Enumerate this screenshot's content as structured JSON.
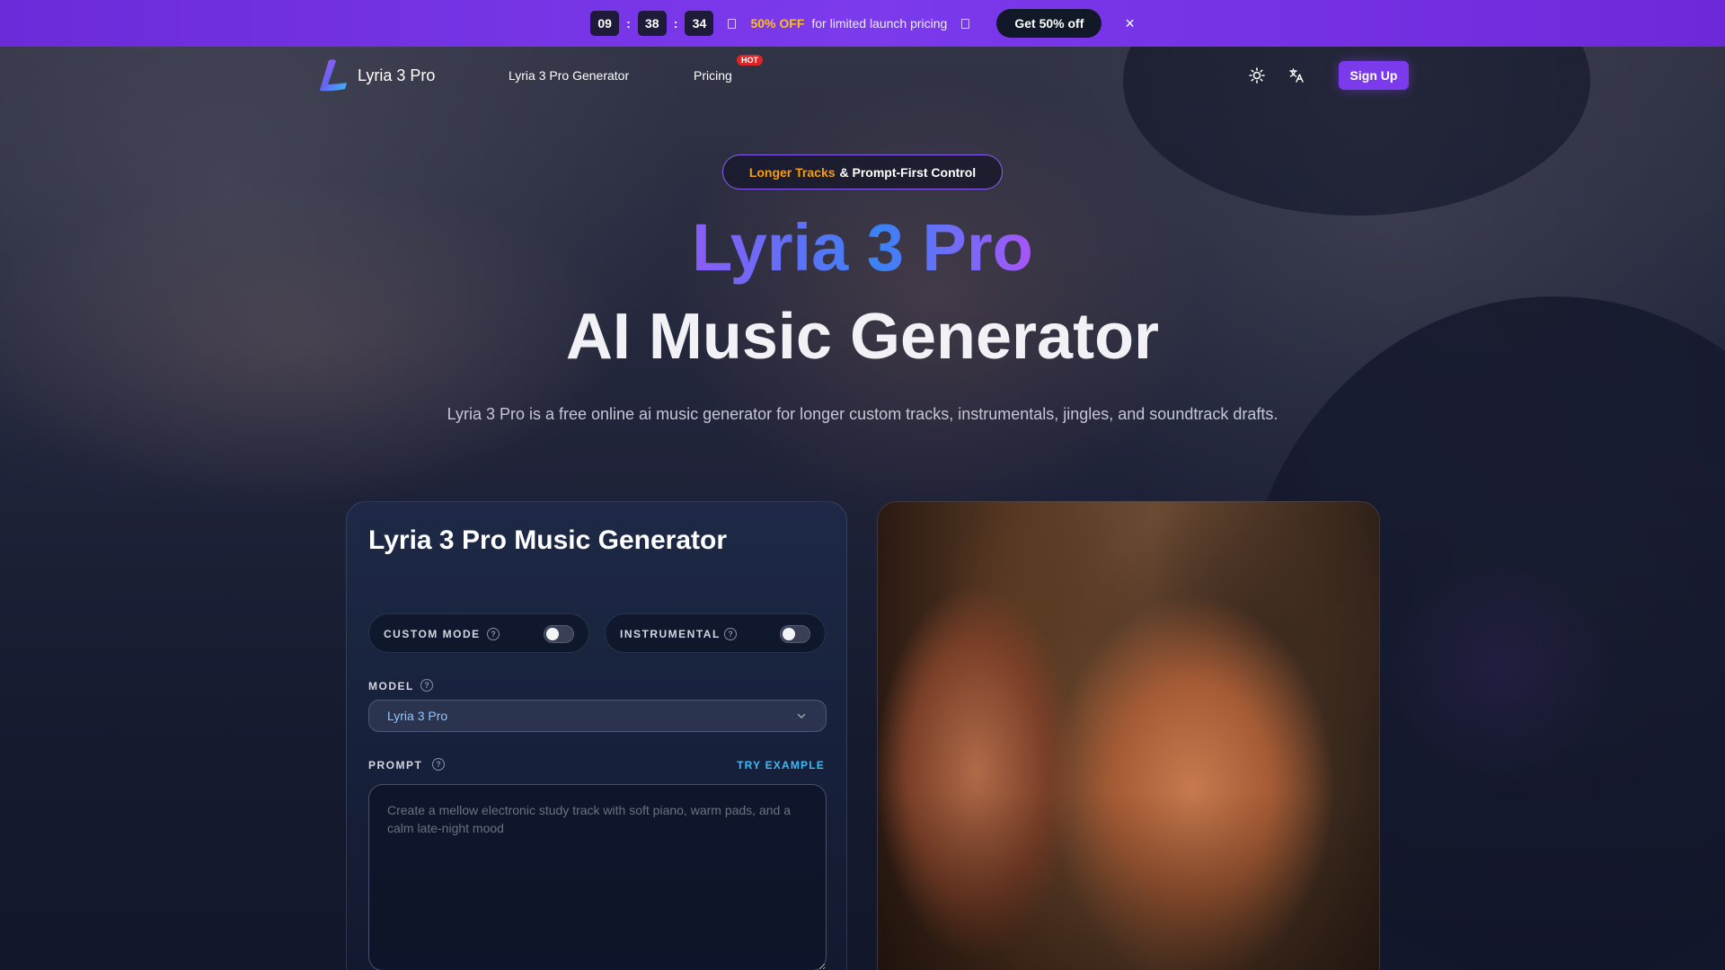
{
  "promo": {
    "hours": "09",
    "minutes": "38",
    "seconds": "34",
    "discount": "50% OFF",
    "message": "for limited launch pricing",
    "cta": "Get 50% off",
    "close": "×"
  },
  "nav": {
    "brand": "Lyria 3 Pro",
    "links": [
      "Lyria 3 Pro Generator",
      "Pricing"
    ],
    "hot_badge": "HOT",
    "signup": "Sign Up"
  },
  "hero": {
    "pill_highlight": "Longer Tracks",
    "pill_rest": "& Prompt-First Control",
    "title": "Lyria 3 Pro",
    "subtitle": "AI Music Generator",
    "description": "Lyria 3 Pro is a free online ai music generator for longer custom tracks, instrumentals, jingles, and soundtrack drafts."
  },
  "generator": {
    "title": "Lyria 3 Pro Music Generator",
    "custom_mode_label": "CUSTOM MODE",
    "custom_mode_on": false,
    "instrumental_label": "INSTRUMENTAL",
    "instrumental_on": false,
    "model_label": "MODEL",
    "model_value": "Lyria 3 Pro",
    "prompt_label": "PROMPT",
    "try_example": "TRY EXAMPLE",
    "prompt_placeholder": "Create a mellow electronic study track with soft piano, warm pads, and a calm late-night mood",
    "help_glyph": "?"
  },
  "colors": {
    "accent": "#7c3aed",
    "highlight": "#f59e0b",
    "link": "#38bdf8"
  }
}
